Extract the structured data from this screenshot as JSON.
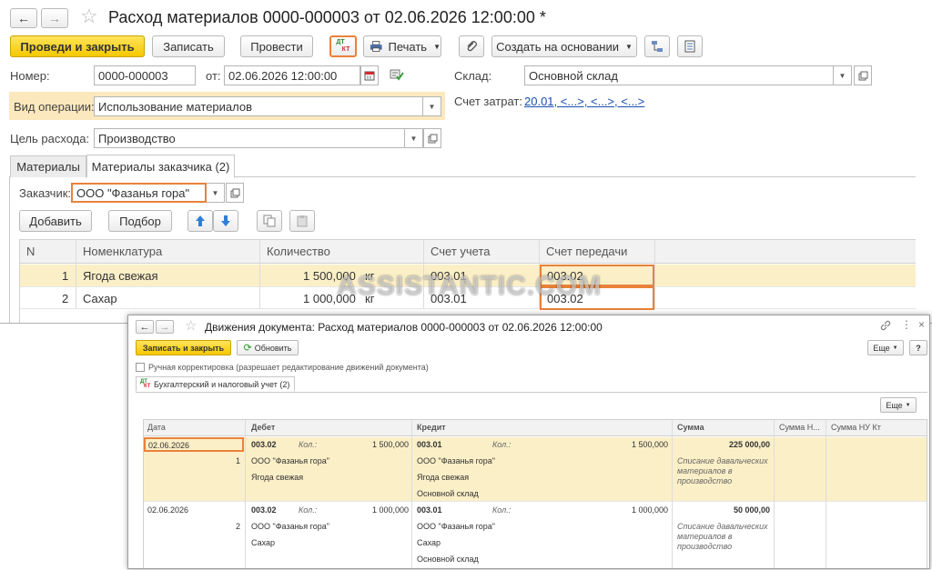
{
  "main": {
    "title": "Расход материалов 0000-000003 от 02.06.2026 12:00:00 *",
    "toolbar": {
      "post_close": "Проведи и закрыть",
      "save": "Записать",
      "post": "Провести",
      "dtkt_top": "ДТ",
      "dtkt_bottom": "КТ",
      "print": "Печать",
      "create_based": "Создать на основании"
    },
    "fields": {
      "number_label": "Номер:",
      "number_value": "0000-000003",
      "date_label": "от:",
      "date_value": "02.06.2026 12:00:00",
      "warehouse_label": "Склад:",
      "warehouse_value": "Основной склад",
      "cost_account_label": "Счет затрат:",
      "cost_account_value": "20.01, <...>, <...>, <...>",
      "operation_label": "Вид операции:",
      "operation_value": "Использование материалов",
      "purpose_label": "Цель расхода:",
      "purpose_value": "Производство"
    },
    "tabs": [
      {
        "label": "Материалы"
      },
      {
        "label": "Материалы заказчика (2)"
      }
    ],
    "customer_label": "Заказчик:",
    "customer_value": "ООО \"Фазанья гора\"",
    "table_toolbar": {
      "add": "Добавить",
      "pick": "Подбор"
    },
    "table": {
      "headers": [
        "N",
        "Номенклатура",
        "Количество",
        "Счет учета",
        "Счет передачи"
      ],
      "rows": [
        {
          "n": "1",
          "item": "Ягода свежая",
          "qty": "1 500,000",
          "unit": "кг",
          "account": "003.01",
          "transfer": "003.02"
        },
        {
          "n": "2",
          "item": "Сахар",
          "qty": "1 000,000",
          "unit": "кг",
          "account": "003.01",
          "transfer": "003.02"
        }
      ]
    }
  },
  "watermark": "ASSISTANTIC.COM",
  "movements": {
    "title": "Движения документа: Расход материалов 0000-000003 от 02.06.2026 12:00:00",
    "save_close": "Записать и закрыть",
    "refresh": "Обновить",
    "more": "Еще",
    "help": "?",
    "manual_label": "Ручная корректировка (разрешает редактирование движений документа)",
    "tab": "Бухгалтерский и налоговый учет (2)",
    "headers": {
      "date": "Дата",
      "debit": "Дебет",
      "credit": "Кредит",
      "sum": "Сумма",
      "sum_n": "Сумма Н...",
      "sum_nu_kt": "Сумма НУ Кт"
    },
    "kol": "Кол.:",
    "rows": [
      {
        "date": "02.06.2026",
        "n": "1",
        "debit_account": "003.02",
        "debit_qty": "1 500,000",
        "debit_sub1": "ООО \"Фазанья гора\"",
        "debit_sub2": "Ягода свежая",
        "credit_account": "003.01",
        "credit_qty": "1 500,000",
        "credit_sub1": "ООО \"Фазанья гора\"",
        "credit_sub2": "Ягода свежая",
        "credit_sub3": "Основной склад",
        "sum": "225 000,00",
        "comment1": "Списание давальческих",
        "comment2": "материалов в",
        "comment3": "производство"
      },
      {
        "date": "02.06.2026",
        "n": "2",
        "debit_account": "003.02",
        "debit_qty": "1 000,000",
        "debit_sub1": "ООО \"Фазанья гора\"",
        "debit_sub2": "Сахар",
        "credit_account": "003.01",
        "credit_qty": "1 000,000",
        "credit_sub1": "ООО \"Фазанья гора\"",
        "credit_sub2": "Сахар",
        "credit_sub3": "Основной склад",
        "sum": "50 000,00",
        "comment1": "Списание давальческих",
        "comment2": "материалов в",
        "comment3": "производство"
      }
    ]
  }
}
